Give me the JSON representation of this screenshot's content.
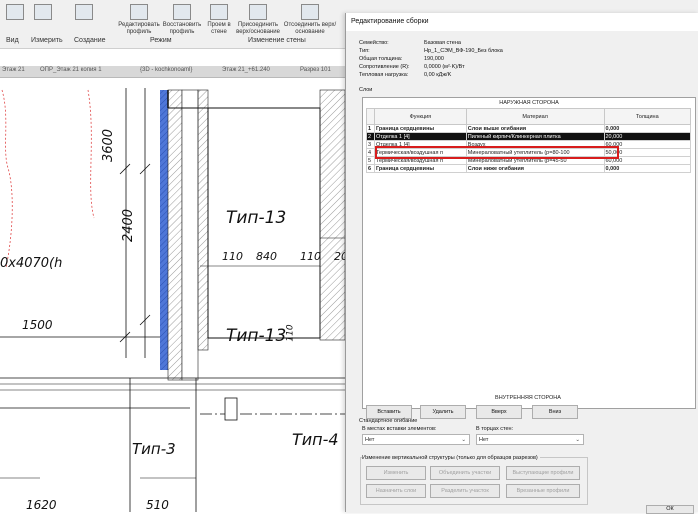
{
  "ribbon": {
    "buttons": [
      "Редактировать профиль",
      "Восстановить профиль",
      "Проем в стене",
      "Присоединить верх/основание",
      "Отсоединить верх/основание"
    ],
    "groups": [
      "Вид",
      "Измерить",
      "Создание",
      "Режим",
      "Изменение стены"
    ]
  },
  "tabs": [
    "Этаж 21",
    "ОПР_Этаж 21 копия 1",
    "{3D - kochkonoaml}",
    "Этаж 21_+61.240",
    "Разрез 101"
  ],
  "drawing": {
    "labels": [
      "3600",
      "2400",
      "Тип-13",
      "110",
      "840",
      "110",
      "20",
      "0x4070(h",
      "1500",
      "Тип-13",
      "110",
      "Тип-3",
      "Тип-4",
      "1620",
      "510"
    ]
  },
  "dialog": {
    "title": "Редактирование сборки",
    "props": [
      {
        "label": "Семейство:",
        "value": "Базовая стена"
      },
      {
        "label": "Тип:",
        "value": "Нр_1_СЭМ_ВФ-190_Без блока"
      },
      {
        "label": "Общая толщина:",
        "value": "190,000"
      },
      {
        "label": "Сопротивление (R):",
        "value": "0,0000 (м²·K)/Вт"
      },
      {
        "label": "Тепловая нагрузка:",
        "value": "0,00 кДж/K"
      }
    ],
    "layers_label": "Слои",
    "exterior_label": "НАРУЖНАЯ СТОРОНА",
    "interior_label": "ВНУТРЕННЯЯ СТОРОНА",
    "columns": [
      "",
      "Функция",
      "Материал",
      "Толщина"
    ],
    "rows": [
      {
        "n": "1",
        "func": "Граница сердцевины",
        "mat": "Слои выше огибания",
        "thick": "0,000"
      },
      {
        "n": "2",
        "func": "Отделка 1 [4]",
        "mat": "Пиленый кирпич/Клинкерная плитка",
        "thick": "20,000"
      },
      {
        "n": "3",
        "func": "Отделка 1 [4]",
        "mat": "Воздух",
        "thick": "60,000"
      },
      {
        "n": "4",
        "func": "Термическая/воздушная п",
        "mat": "Минераловатный утеплитель (р=80-100",
        "thick": "50,000"
      },
      {
        "n": "5",
        "func": "Термическая/воздушная п",
        "mat": "Минераловатный утеплитель (р=45-50",
        "thick": "60,000"
      },
      {
        "n": "6",
        "func": "Граница сердцевины",
        "mat": "Слои ниже огибания",
        "thick": "0,000"
      }
    ],
    "buttons": {
      "insert": "Вставить",
      "delete": "Удалить",
      "up": "Вверх",
      "down": "Вниз"
    },
    "wrap": {
      "title": "Стандартное огибание",
      "insert_label": "В местах вставки элементов:",
      "insert_value": "Нет",
      "ends_label": "В торцах стен:",
      "ends_value": "Нет"
    },
    "vert": {
      "title": "Изменение вертикальной структуры (только для образцов разрезов)",
      "modify": "Изменить",
      "merge": "Объединить участки",
      "sweeps": "Выступающие профили",
      "assign": "Назначить слои",
      "split": "Разделить участок",
      "reveals": "Врезанные профили"
    },
    "ok": "ОК"
  }
}
